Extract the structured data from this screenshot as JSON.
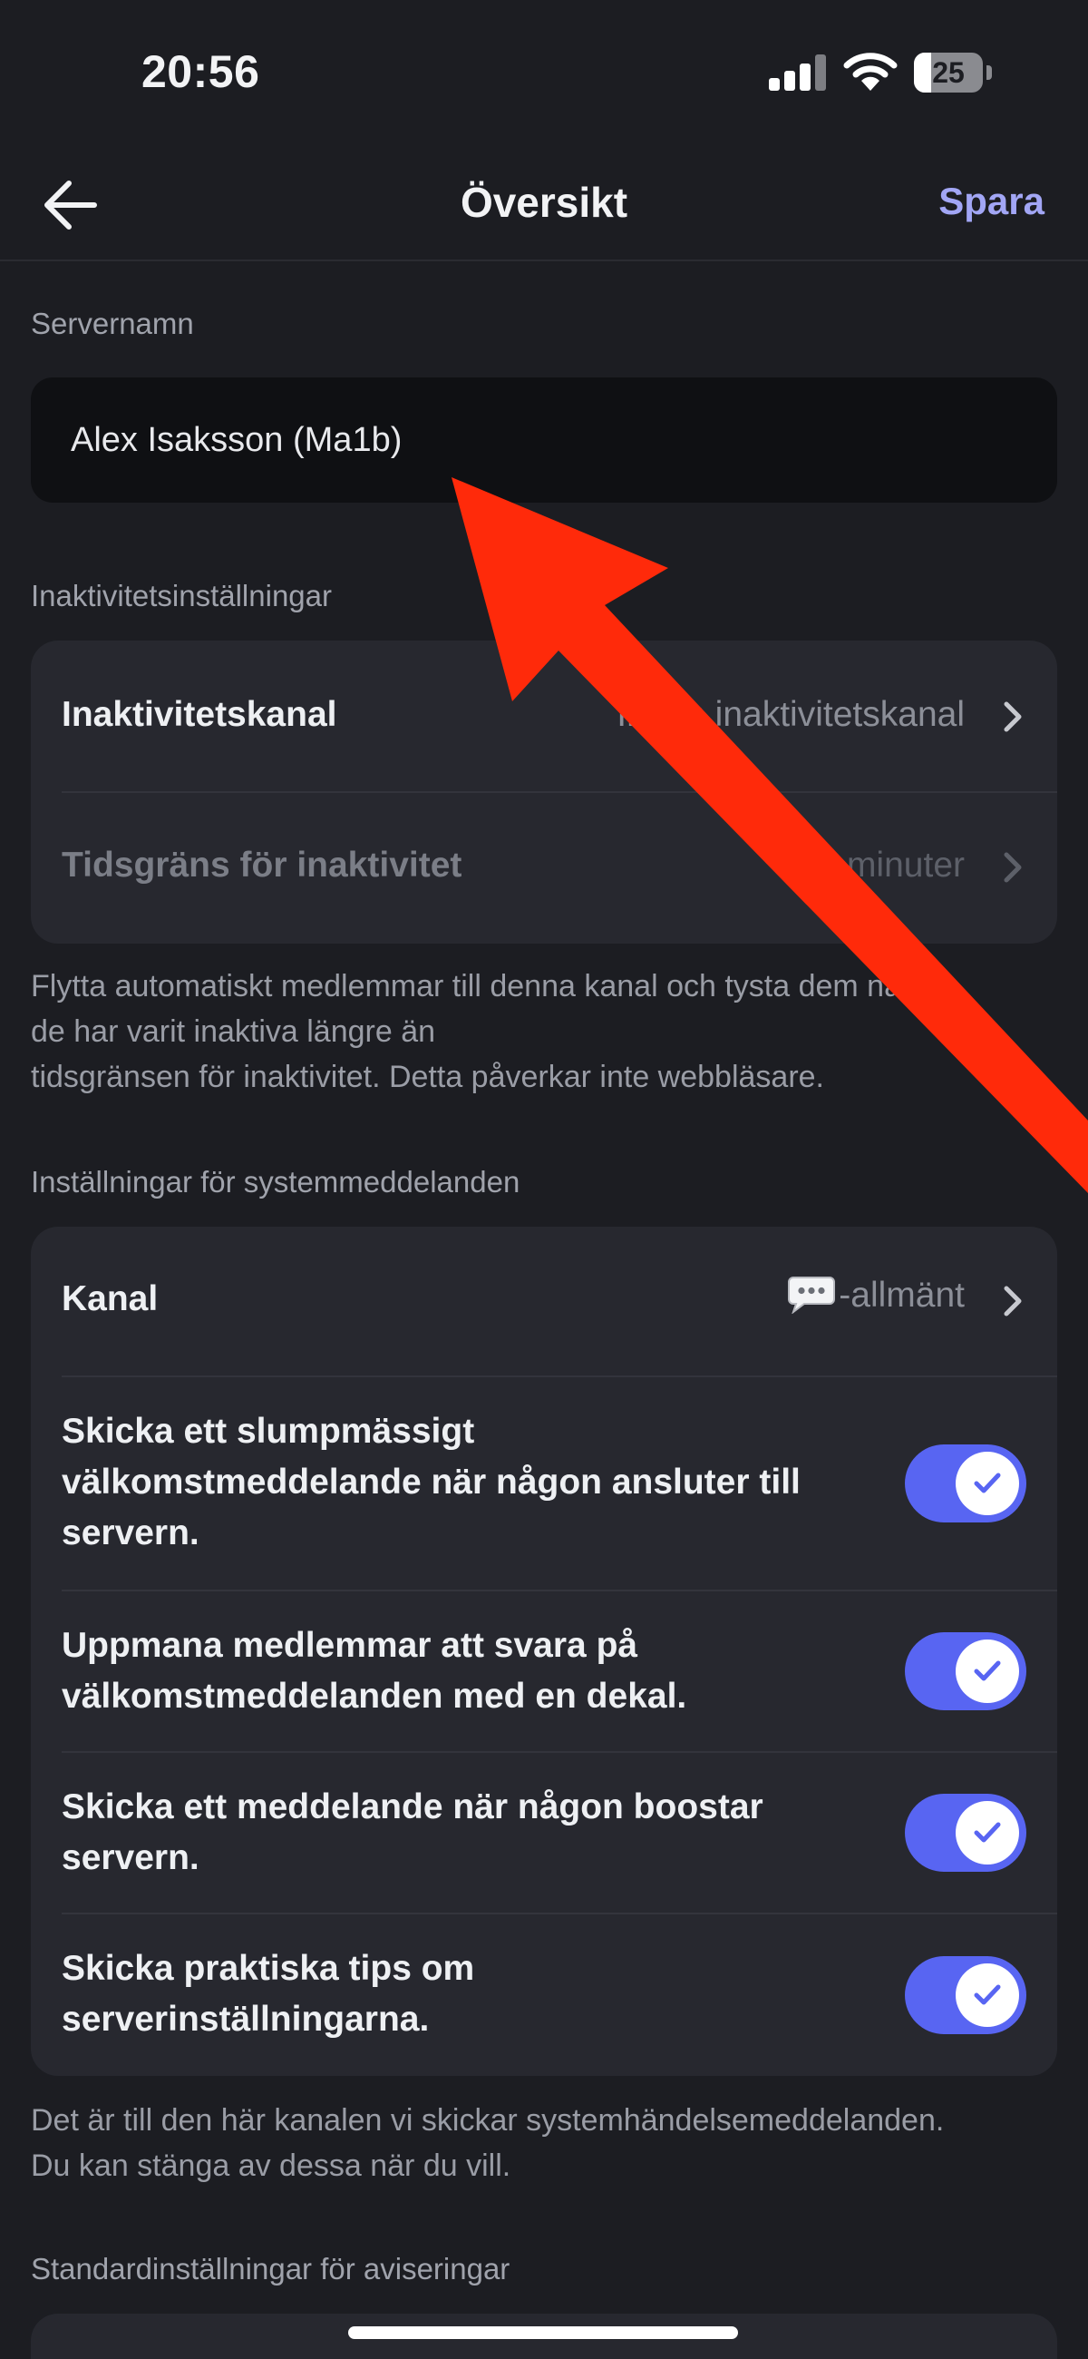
{
  "status_bar": {
    "time": "20:56",
    "battery": "25",
    "battery_level": 0.25
  },
  "nav": {
    "title": "Översikt",
    "save_label": "Spara"
  },
  "server_name": {
    "label": "Servernamn",
    "value": "Alex Isaksson (Ma1b)"
  },
  "inactivity": {
    "section_label": "Inaktivitetsinställningar",
    "channel_label": "Inaktivitetskanal",
    "channel_value": "Ingen inaktivitetskanal",
    "timeout_label": "Tidsgräns för inaktivitet",
    "timeout_value": "5 minuter",
    "help_line1": "Flytta automatiskt medlemmar till denna kanal och tysta dem när",
    "help_line2": "de har varit inaktiva längre än",
    "help_line3": "tidsgränsen för inaktivitet. Detta påverkar inte webbläsare."
  },
  "system_messages": {
    "section_label": "Inställningar för systemmeddelanden",
    "channel_label": "Kanal",
    "channel_value": "-allmänt",
    "channel_icon": "speech-bubble-icon",
    "toggles": [
      {
        "line1": "Skicka ett slumpmässigt",
        "line2": "välkomstmeddelande när någon ansluter till",
        "line3": "servern.",
        "enabled": true
      },
      {
        "line1": "Uppmana medlemmar att svara på",
        "line2": "välkomstmeddelanden med en dekal.",
        "enabled": true
      },
      {
        "line1": "Skicka ett meddelande när någon boostar",
        "line2": "servern.",
        "enabled": true
      },
      {
        "line1": "Skicka praktiska tips om",
        "line2": "serverinställningarna.",
        "enabled": true
      }
    ],
    "help_line1": "Det är till den här kanalen vi skickar systemhändelsemeddelanden.",
    "help_line2": "Du kan stänga av dessa när du vill."
  },
  "notifications": {
    "section_label": "Standardinställningar för aviseringar"
  },
  "colors": {
    "background": "#1c1d22",
    "card": "#27282f",
    "accent": "#5865f2",
    "save": "#a2a6f5",
    "annotation_arrow": "#ff2a0a"
  }
}
